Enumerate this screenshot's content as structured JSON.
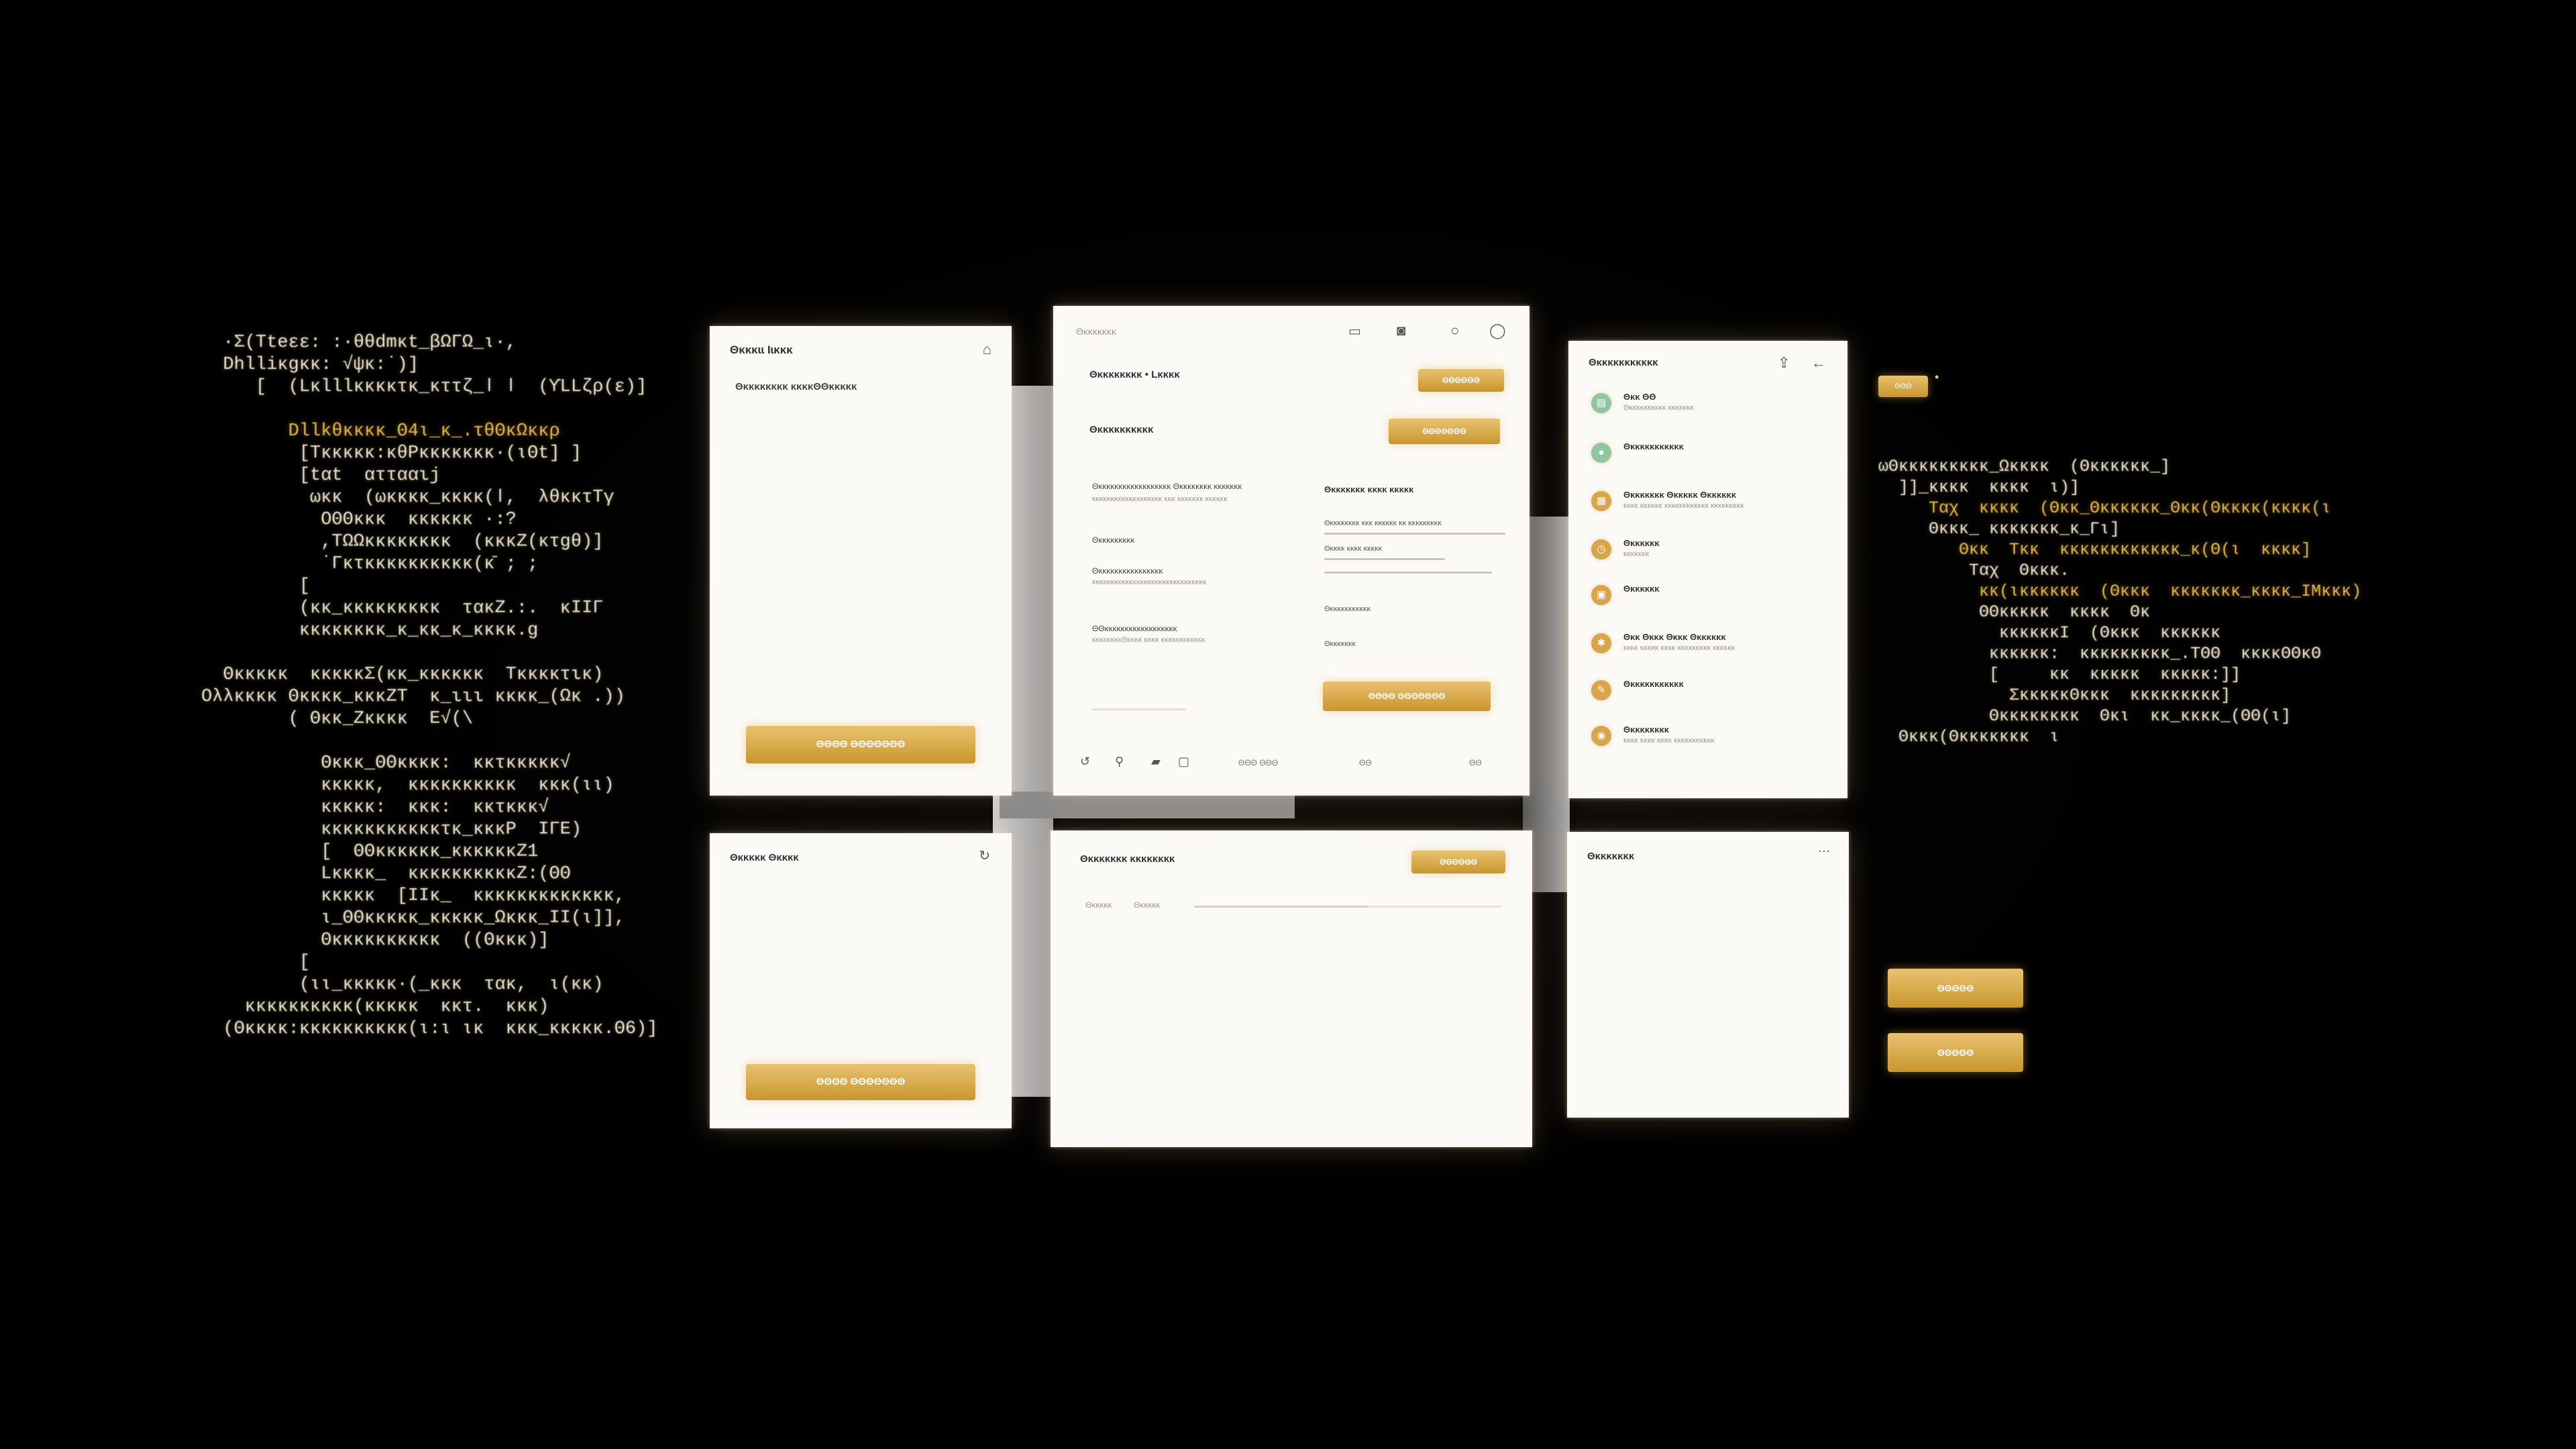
{
  "code_left": {
    "lines": [
      {
        "text": "  ·Σ(Tteεε: :·θθdmκt_βΩΓΩ_ɩ·,",
        "gold": false
      },
      {
        "text": "  Dhlliκgκκ: √ψκ:˙)]",
        "gold": false
      },
      {
        "text": "     [  (Lκlllκκκκτκ_κττζ_ǀ ǀ  (ϒLLζρ(ε)]",
        "gold": false
      },
      {
        "text": "",
        "gold": false
      },
      {
        "text": "        Dllkθκκκκ_Θ4ɩ_κ_.τθΘκΩκκρ",
        "gold": true
      },
      {
        "text": "         [Tκκκκκ:κθΡκκκκκκκ·(ɩΘt] ]",
        "gold": false
      },
      {
        "text": "         [tαt  αττααιj",
        "gold": false
      },
      {
        "text": "          ωκκ  (ωκκκκ_κκκκ(ǀ,  λθκκτΤγ",
        "gold": false
      },
      {
        "text": "           ΟΘΘκκκ  κκκκκκ ·:?",
        "gold": false
      },
      {
        "text": "           ,ΤΩΩκκκκκκκκ  (κκκΖ(κτgθ)]",
        "gold": false
      },
      {
        "text": "           ˙Γκτκκκκκκκκκκ(κ̄ ; ;",
        "gold": false
      },
      {
        "text": "         [",
        "gold": false
      },
      {
        "text": "         (κκ_κκκκκκκκκ  τακΖ.:.  κΙΙΓ",
        "gold": false
      },
      {
        "text": "         κκκκκκκκ_κ_κκ_κ_κκκκ.ɡ",
        "gold": false
      },
      {
        "text": "",
        "gold": false
      },
      {
        "text": "  Θκκκκκ  κκκκκΣ(κκ_κκκκκκ  Τκκκκτικ)",
        "gold": false
      },
      {
        "text": "Oλλκκκκ Θκκκκ_κκκΖΤ  κ_ιιι κκκκ_(Ωκ .))",
        "gold": false
      },
      {
        "text": "        ( Θκκ_Ζκκκκ  Ε√(\\",
        "gold": false
      },
      {
        "text": "",
        "gold": false
      },
      {
        "text": "           Θκκκ_ΘΘκκκκ:  κκτκκκκκ√",
        "gold": false
      },
      {
        "text": "           κκκκκ,  κκκκκκκκκκ  κκκ(ɩɩ)",
        "gold": false
      },
      {
        "text": "           κκκκκ:  κκκ:  κκτκκκ√",
        "gold": false
      },
      {
        "text": "           κκκκκκκκκκκτκ_κκκΡ  ΙΓΕ)",
        "gold": false
      },
      {
        "text": "           [  ΘΘκκκκκκ_κκκκκκΖ1",
        "gold": false
      },
      {
        "text": "           Lκκκκ_  κκκκκκκκκκΖ:(ΘΘ",
        "gold": false
      },
      {
        "text": "           κκκκκ  [ΙΙκ_  κκκκκκκκκκκκκ,",
        "gold": false
      },
      {
        "text": "           ɩ_ΘΘκκκκκ_κκκκκ_Ωκκκ_ΙΙ(ɩ]],",
        "gold": false
      },
      {
        "text": "           Θκκκκκκκκκκ  ((Θκκκ)]",
        "gold": false
      },
      {
        "text": "         [",
        "gold": false
      },
      {
        "text": "         (ɩɩ_κκκκκ·(_κκκ  τακ,  ɩ(κκ)",
        "gold": false
      },
      {
        "text": "    κκκκκκκκκκ(κκκκκ  κκτ.  κκκ)",
        "gold": false
      },
      {
        "text": "  (Θκκκκ:κκκκκκκκκκ(ɩ:ɩ ɩκ  κκκ_κκκκκ.Θ6)]",
        "gold": false
      }
    ]
  },
  "code_right": {
    "lines": [
      {
        "text": "ωΘκκκκκκκκκ_Ωκκκκ  (Θκκκκκκ_]",
        "gold": false
      },
      {
        "text": "  ]]_κκκκ  κκκκ  ɩ)]",
        "gold": false
      },
      {
        "text": "     Ταχ  κκκκ  (Θκκ_Θκκκκκκ_Θκκ(Θκκκκ(κκκκ(ɩ",
        "gold": true
      },
      {
        "text": "     Θκκκ_ κκκκκκκ_κ_Γɩ]",
        "gold": false
      },
      {
        "text": "        Θκκ  Τκκ  κκκκκκκκκκκκ_κ(Θ(ɩ  κκκκ]",
        "gold": true
      },
      {
        "text": "         Ταχ  Θκκκ.",
        "gold": false
      },
      {
        "text": "          κκ(ɩκκκκκκ  (Θκκκ  κκκκκκκ_κκκκ_ΙΜκκκ)",
        "gold": true
      },
      {
        "text": "          ΘΘκκκκκ  κκκκ  Θκ",
        "gold": false
      },
      {
        "text": "            κκκκκκΙ  (Θκκκ  κκκκκκ",
        "gold": false
      },
      {
        "text": "           κκκκκκ:  κκκκκκκκκ_.ΤΘΘ  κκκκΘΘκΘ",
        "gold": false
      },
      {
        "text": "           [     κκ  κκκκκ  κκκκκ:]]",
        "gold": false
      },
      {
        "text": "             ΣκκκκκΘκκκ  κκκκκκκκκ]",
        "gold": false
      },
      {
        "text": "           Θκκκκκκκκ  Θκɩ  κκ_κκκκ_(ΘΘ(ɩ]",
        "gold": false
      },
      {
        "text": "  Θκκκ(Θκκκκκκκ  ɩ",
        "gold": false
      }
    ]
  },
  "win1": {
    "title": "Θκκκɩɩ Ιɩκκκ",
    "subtitle": "Θκκκκκκκκ  κκκκΘΘκκκκκ",
    "button": "ΘΘΘΘ  ΘΘΘΘΘΘΘ",
    "icon": "home-icon"
  },
  "win2": {
    "title": "Θκκκκκκκ",
    "header_icons": [
      "message-icon",
      "camera-icon",
      "search-icon",
      "user-icon"
    ],
    "row1_label": "Θκκκκκκκκ • Lκκκκ",
    "row1_button": "ΘΘΘΘΘΘ",
    "row2_label": "Θκκκκκκκκκκ",
    "row2_button": "ΘΘΘΘΘΘΘ",
    "left_col": {
      "block1_title": "Θκκκκκκκκκκκκκκκκκκ  Θκκκκκκκκ  κκκκκκκ",
      "block1_sub": "κκκκκκκκκκκκκκκκκκκ  κκκ  κκκκκκκ  κκκκκκ",
      "block2_title": "Θκκκκκκκκκ",
      "block3_title": "Θκκκκκκκκκκκκκκκκ",
      "block3_sub": "κκκκκκκκκκκκκκκκκκκκκκκκκκκκκκκ",
      "block4_title": "ΘΘκκκκκκκκκκκκκκκκκκ",
      "block4_sub": "κκκκκκκκΘκκκκ  κκκκ  κκκκκκκκκκκκ"
    },
    "right_col": {
      "heading": "Θκκκκκκκ  κκκκ  κκκκκ",
      "field1": "Θκκκκκκκκ  κκκ  κκκκκκ  κκ  κκκκκκκκκ",
      "field2": "Θκκκκ  κκκκ  κκκκκ",
      "field3": "Θκκκκκκκκκκκ",
      "field4": "Θκκκκκκκ",
      "submit": "ΘΘΘΘ  ΘΘΘΘΘΘΘ"
    },
    "footer": {
      "icons": [
        "refresh-icon",
        "pin-icon",
        "folder-icon",
        "window-icon"
      ],
      "text1": "ΘΘΘ  ΘΘΘ",
      "text2": "ΘΘ",
      "text3": "ΘΘ"
    }
  },
  "win3": {
    "title": "Θκκκκκκκκκκκ",
    "header_icons": [
      "upload-icon",
      "back-icon"
    ],
    "items": [
      {
        "title": "Θκκ  ΘΘ",
        "sub": "Θκκκκκκκκκκ  κκκκκκκ",
        "icon": "chart-icon",
        "color": "green"
      },
      {
        "title": "Θκκκκκκκκκκκ",
        "sub": "",
        "icon": "circle-icon",
        "color": "green"
      },
      {
        "title": "Θκκκκκκκ  Θκκκκκ  Θκκκκκκ",
        "sub": "κκκκ  κκκκκκ  κκκκκκκκκκκκ  κκκκκκκκκ",
        "icon": "document-icon",
        "color": "gold"
      },
      {
        "title": "Θκκκκκκ",
        "sub": "κκκκκκκ",
        "icon": "clock-icon",
        "color": "gold"
      },
      {
        "title": "Θκκκκκκ",
        "sub": "",
        "icon": "file-icon",
        "color": "gold"
      },
      {
        "title": "Θκκ  Θκκκ  Θκκκ  Θκκκκκκ",
        "sub": "κκκκ  κκκκκ  κκκκ  κκκκκκκκκ  κκκκκκ",
        "icon": "gear-icon",
        "color": "gold"
      },
      {
        "title": "Θκκκκκκκκκκκ",
        "sub": "",
        "icon": "edit-icon",
        "color": "gold"
      },
      {
        "title": "Θκκκκκκκκ",
        "sub": "κκκκ  κκκκ  κκκκ  κκκκκκκκκκκ",
        "icon": "bell-icon",
        "color": "gold"
      }
    ]
  },
  "win4": {
    "title": "Θκκκκκ  Θκκκκ",
    "button": "ΘΘΘΘ  ΘΘΘΘΘΘΘ",
    "icon": "refresh-icon"
  },
  "win5": {
    "title": "Θκκκκκκκ  κκκκκκκκ",
    "button": "ΘΘΘΘΘΘ",
    "tabs": [
      "Θκκκκκ",
      "Θκκκκκ"
    ]
  },
  "win6": {
    "title": "Θκκκκκκκ",
    "icon": "more-icon"
  },
  "floating": {
    "tag": "ΘΘΘ",
    "button1": "ΘΘΘΘΘ",
    "button2": "ΘΘΘΘΘ"
  },
  "colors": {
    "gold": "#d4a545",
    "gold_light": "#e9c270",
    "background": "#000000",
    "window": "#fbfaf7"
  }
}
